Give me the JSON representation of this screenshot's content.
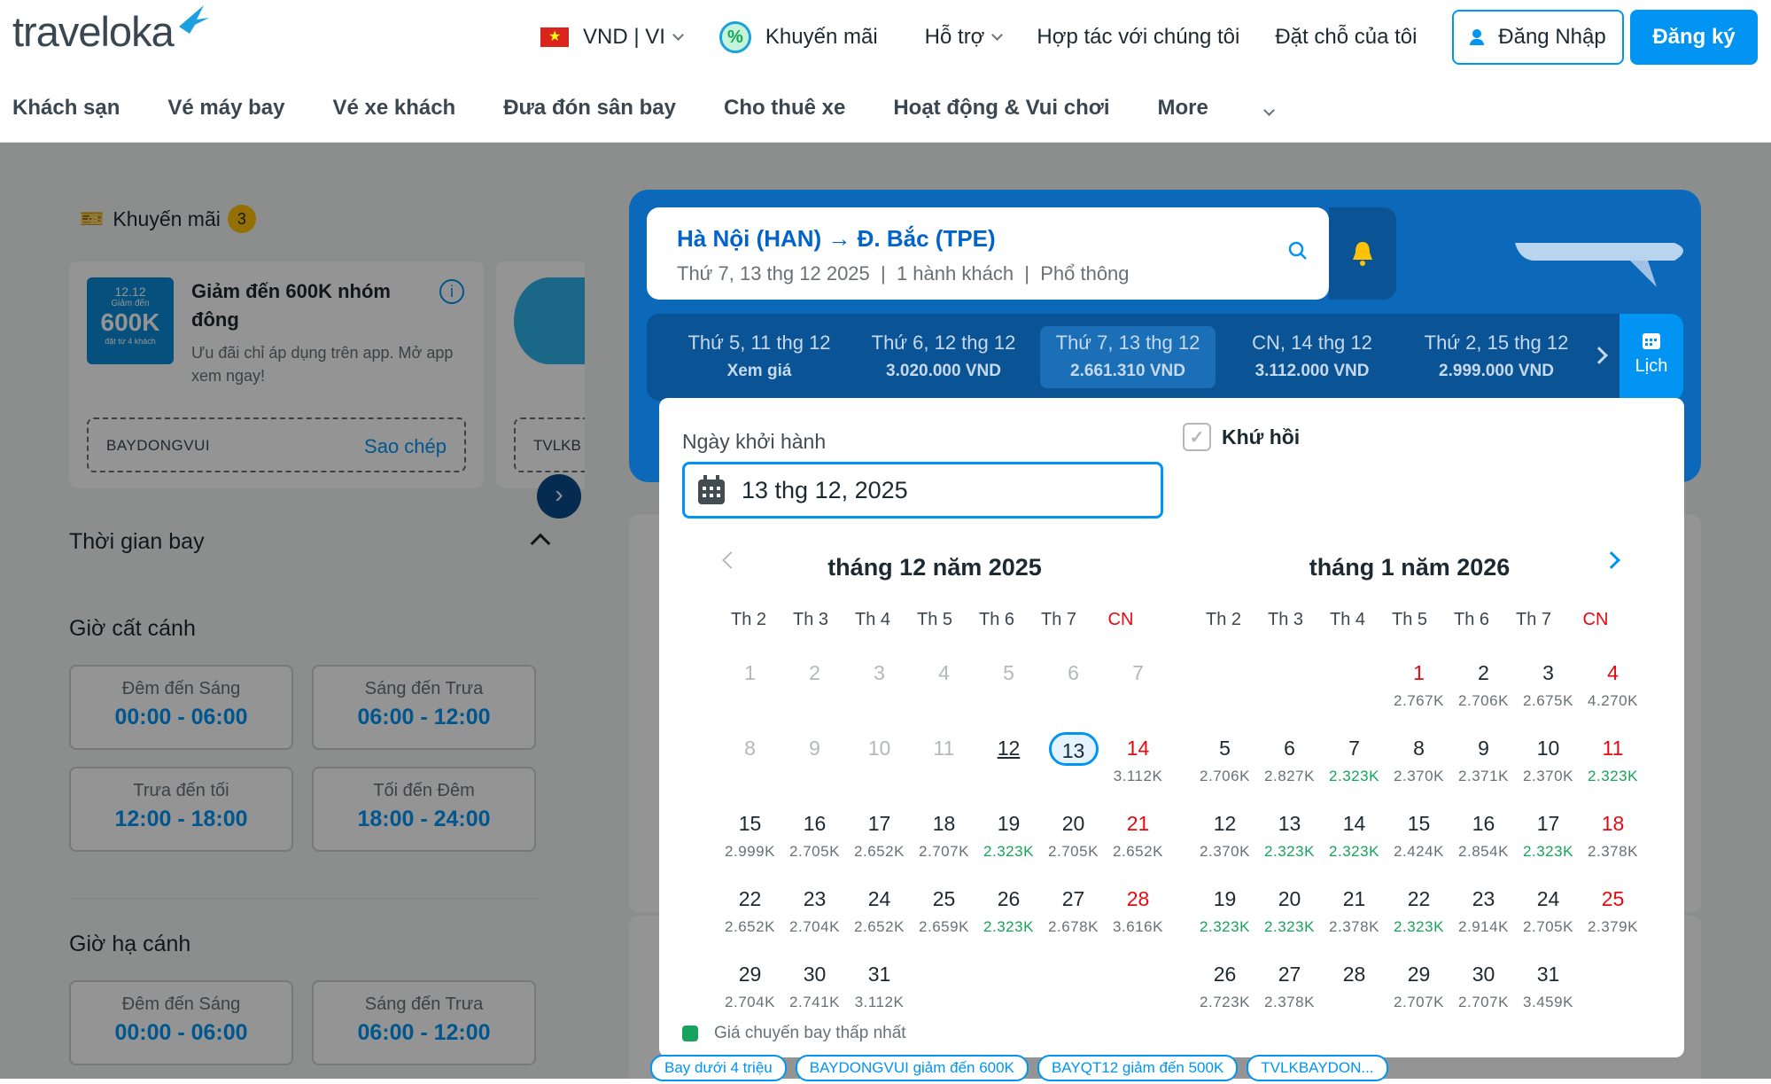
{
  "header": {
    "logo": "traveloka",
    "currency": "VND | VI",
    "promo": "Khuyến mãi",
    "support": "Hỗ trợ",
    "partner": "Hợp tác với chúng tôi",
    "bookings": "Đặt chỗ của tôi",
    "login": "Đăng Nhập",
    "register": "Đăng ký"
  },
  "subnav": [
    "Khách sạn",
    "Vé máy bay",
    "Vé xe khách",
    "Đưa đón sân bay",
    "Cho thuê xe",
    "Hoạt động & Vui chơi",
    "More"
  ],
  "sidebar": {
    "promo_title": "Khuyến mãi",
    "promo_count": "3",
    "coupon": {
      "img_top": "12.12",
      "img_mid": "Giảm đến",
      "img_big": "600K",
      "img_sub": "đặt từ 4 khách",
      "title": "Giảm đến 600K nhóm đông",
      "desc": "Ưu đãi chỉ áp dụng trên app. Mở app xem ngay!",
      "code": "BAYDONGVUI",
      "copy": "Sao chép",
      "code2": "TVLKB"
    },
    "flight_time": "Thời gian bay",
    "depart_title": "Giờ cất cánh",
    "arrive_title": "Giờ hạ cánh",
    "slots": [
      {
        "label": "Đêm đến Sáng",
        "time": "00:00 - 06:00"
      },
      {
        "label": "Sáng đến Trưa",
        "time": "06:00 - 12:00"
      },
      {
        "label": "Trưa đến tối",
        "time": "12:00 - 18:00"
      },
      {
        "label": "Tối đến Đêm",
        "time": "18:00 - 24:00"
      }
    ]
  },
  "search": {
    "route": "Hà Nội (HAN) → Đ. Bắc (TPE)",
    "details": "Thứ 7, 13 thg 12 2025  |  1 hành khách  |  Phổ thông"
  },
  "date_strip": [
    {
      "day": "Thứ 5, 11 thg 12",
      "price": "Xem giá"
    },
    {
      "day": "Thứ 6, 12 thg 12",
      "price": "3.020.000 VND"
    },
    {
      "day": "Thứ 7, 13 thg 12",
      "price": "2.661.310 VND"
    },
    {
      "day": "CN, 14 thg 12",
      "price": "3.112.000 VND"
    },
    {
      "day": "Thứ 2, 15 thg 12",
      "price": "2.999.000 VND"
    }
  ],
  "calendar_btn": "Lịch",
  "picker": {
    "label": "Ngày khởi hành",
    "value": "13 thg 12, 2025",
    "roundtrip": "Khứ hồi",
    "weekdays": [
      "Th 2",
      "Th 3",
      "Th 4",
      "Th 5",
      "Th 6",
      "Th 7",
      "CN"
    ],
    "legend": "Giá chuyến bay thấp nhất",
    "months": [
      {
        "title": "tháng 12 năm 2025",
        "offset": 0,
        "days": [
          {
            "d": "1",
            "s": "dis"
          },
          {
            "d": "2",
            "s": "dis"
          },
          {
            "d": "3",
            "s": "dis"
          },
          {
            "d": "4",
            "s": "dis"
          },
          {
            "d": "5",
            "s": "dis"
          },
          {
            "d": "6",
            "s": "dis"
          },
          {
            "d": "7",
            "s": "dis"
          },
          {
            "d": "8",
            "s": "dis"
          },
          {
            "d": "9",
            "s": "dis"
          },
          {
            "d": "10",
            "s": "dis"
          },
          {
            "d": "11",
            "s": "dis"
          },
          {
            "d": "12",
            "s": "und"
          },
          {
            "d": "13",
            "s": "sel"
          },
          {
            "d": "14",
            "p": "3.112K",
            "s": "sun"
          },
          {
            "d": "15",
            "p": "2.999K"
          },
          {
            "d": "16",
            "p": "2.705K"
          },
          {
            "d": "17",
            "p": "2.652K"
          },
          {
            "d": "18",
            "p": "2.707K"
          },
          {
            "d": "19",
            "p": "2.323K",
            "s": "low"
          },
          {
            "d": "20",
            "p": "2.705K"
          },
          {
            "d": "21",
            "p": "2.652K",
            "s": "sun"
          },
          {
            "d": "22",
            "p": "2.652K"
          },
          {
            "d": "23",
            "p": "2.704K"
          },
          {
            "d": "24",
            "p": "2.652K"
          },
          {
            "d": "25",
            "p": "2.659K"
          },
          {
            "d": "26",
            "p": "2.323K",
            "s": "low"
          },
          {
            "d": "27",
            "p": "2.678K"
          },
          {
            "d": "28",
            "p": "3.616K",
            "s": "sun"
          },
          {
            "d": "29",
            "p": "2.704K"
          },
          {
            "d": "30",
            "p": "2.741K"
          },
          {
            "d": "31",
            "p": "3.112K"
          }
        ]
      },
      {
        "title": "tháng 1 năm 2026",
        "offset": 3,
        "days": [
          {
            "d": "1",
            "p": "2.767K",
            "s": "sun"
          },
          {
            "d": "2",
            "p": "2.706K"
          },
          {
            "d": "3",
            "p": "2.675K"
          },
          {
            "d": "4",
            "p": "4.270K",
            "s": "sun"
          },
          {
            "d": "5",
            "p": "2.706K"
          },
          {
            "d": "6",
            "p": "2.827K"
          },
          {
            "d": "7",
            "p": "2.323K",
            "s": "low"
          },
          {
            "d": "8",
            "p": "2.370K"
          },
          {
            "d": "9",
            "p": "2.371K"
          },
          {
            "d": "10",
            "p": "2.370K"
          },
          {
            "d": "11",
            "p": "2.323K",
            "s": "sun low"
          },
          {
            "d": "12",
            "p": "2.370K"
          },
          {
            "d": "13",
            "p": "2.323K",
            "s": "low"
          },
          {
            "d": "14",
            "p": "2.323K",
            "s": "low"
          },
          {
            "d": "15",
            "p": "2.424K"
          },
          {
            "d": "16",
            "p": "2.854K"
          },
          {
            "d": "17",
            "p": "2.323K",
            "s": "low"
          },
          {
            "d": "18",
            "p": "2.378K",
            "s": "sun"
          },
          {
            "d": "19",
            "p": "2.323K",
            "s": "low"
          },
          {
            "d": "20",
            "p": "2.323K",
            "s": "low"
          },
          {
            "d": "21",
            "p": "2.378K"
          },
          {
            "d": "22",
            "p": "2.323K",
            "s": "low"
          },
          {
            "d": "23",
            "p": "2.914K"
          },
          {
            "d": "24",
            "p": "2.705K"
          },
          {
            "d": "25",
            "p": "2.379K",
            "s": "sun"
          },
          {
            "d": "26",
            "p": "2.723K"
          },
          {
            "d": "27",
            "p": "2.378K"
          },
          {
            "d": "28"
          },
          {
            "d": "29",
            "p": "2.707K"
          },
          {
            "d": "30",
            "p": "2.707K"
          },
          {
            "d": "31",
            "p": "3.459K"
          }
        ]
      }
    ]
  },
  "chips": [
    "Bay dưới 4 triệu",
    "BAYDONGVUI giảm đến 600K",
    "BAYQT12 giảm đến 500K",
    "TVLKBAYDON..."
  ],
  "colors": {
    "brand": "#0194f3",
    "green": "#17a35b",
    "red": "#e7090e"
  }
}
